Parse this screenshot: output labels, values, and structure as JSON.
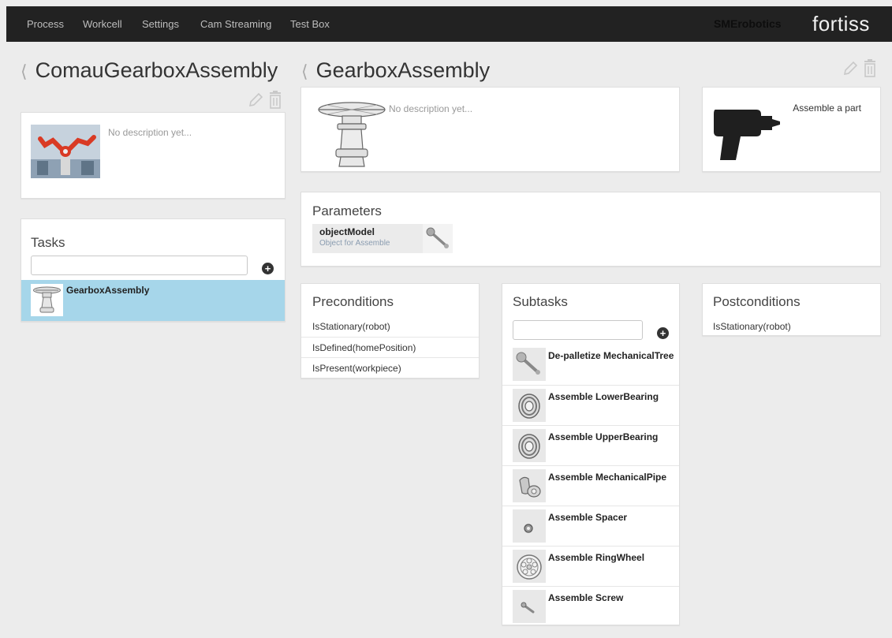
{
  "nav": {
    "items": [
      "Process",
      "Workcell",
      "Settings",
      "Cam Streaming",
      "Test Box"
    ],
    "brand": "SMErobotics",
    "logo": "fortiss"
  },
  "process": {
    "title": "ComauGearboxAssembly",
    "description": "No description yet..."
  },
  "tasks": {
    "title": "Tasks",
    "search_placeholder": "",
    "items": [
      {
        "label": "GearboxAssembly",
        "selected": true
      }
    ]
  },
  "task": {
    "title": "GearboxAssembly",
    "description": "No description yet..."
  },
  "skill": {
    "label": "Assemble a part"
  },
  "parameters": {
    "title": "Parameters",
    "items": [
      {
        "name": "objectModel",
        "description": "Object for Assemble"
      }
    ]
  },
  "preconditions": {
    "title": "Preconditions",
    "items": [
      "IsStationary(robot)",
      "IsDefined(homePosition)",
      "IsPresent(workpiece)"
    ]
  },
  "subtasks": {
    "title": "Subtasks",
    "search_placeholder": "",
    "items": [
      {
        "label": "De-palletize MechanicalTree",
        "icon": "wrench-icon"
      },
      {
        "label": "Assemble LowerBearing",
        "icon": "bearing-icon"
      },
      {
        "label": "Assemble UpperBearing",
        "icon": "bearing-icon"
      },
      {
        "label": "Assemble MechanicalPipe",
        "icon": "pipe-icon"
      },
      {
        "label": "Assemble Spacer",
        "icon": "spacer-icon"
      },
      {
        "label": "Assemble RingWheel",
        "icon": "ring-wheel-icon"
      },
      {
        "label": "Assemble Screw",
        "icon": "screw-icon"
      }
    ]
  },
  "postconditions": {
    "title": "Postconditions",
    "items": [
      "IsStationary(robot)"
    ]
  },
  "colors": {
    "navbar": "#222222",
    "selected_row": "#a6d6ea",
    "page_bg": "#ececec"
  }
}
